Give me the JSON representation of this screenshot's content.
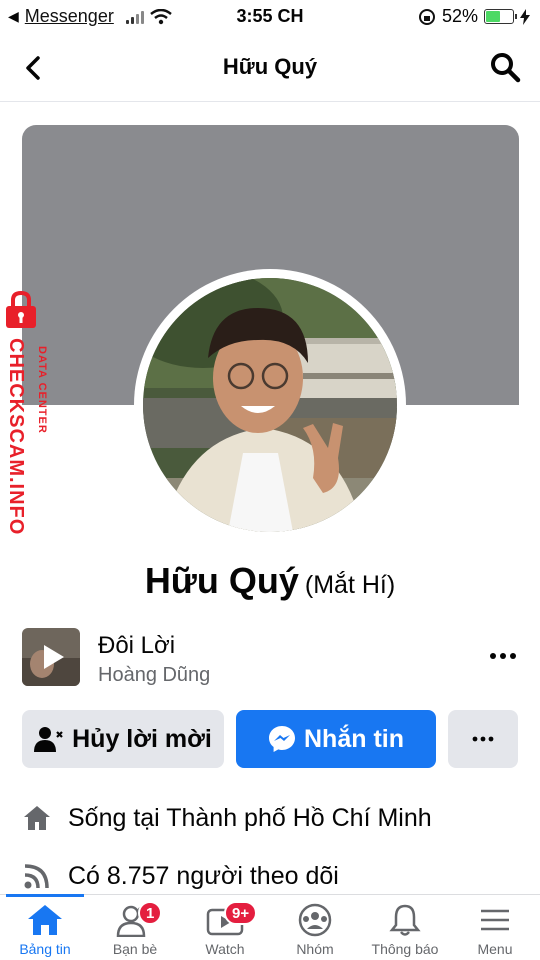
{
  "status_bar": {
    "back_app": "Messenger",
    "time": "3:55 CH",
    "battery": "52%",
    "battery_level": 0.52
  },
  "header": {
    "title": "Hữu Quý",
    "back_icon": "chevron-left-icon",
    "search_icon": "search-icon"
  },
  "profile": {
    "name": "Hữu Quý",
    "alternate_name": "(Mắt Hí)"
  },
  "music": {
    "song": "Đôi Lời",
    "artist": "Hoàng Dũng"
  },
  "actions": {
    "cancel_request": "Hủy lời mời",
    "message": "Nhắn tin"
  },
  "info": {
    "lives_in": "Sống tại Thành phố Hồ Chí Minh",
    "followers": "Có 8.757 người theo dõi"
  },
  "nav": {
    "tabs": [
      {
        "label": "Bảng tin",
        "icon": "home-icon",
        "active": true
      },
      {
        "label": "Bạn bè",
        "icon": "friends-icon",
        "badge": "1"
      },
      {
        "label": "Watch",
        "icon": "watch-icon",
        "badge": "9+"
      },
      {
        "label": "Nhóm",
        "icon": "groups-icon"
      },
      {
        "label": "Thông báo",
        "icon": "bell-icon"
      },
      {
        "label": "Menu",
        "icon": "menu-icon"
      }
    ]
  },
  "watermark": {
    "brand": "CHECKSCAM.INFO",
    "sub": "DATA CENTER"
  },
  "colors": {
    "accent": "#1877f2",
    "badge": "#e41e3f",
    "watermark": "#e8202a"
  }
}
